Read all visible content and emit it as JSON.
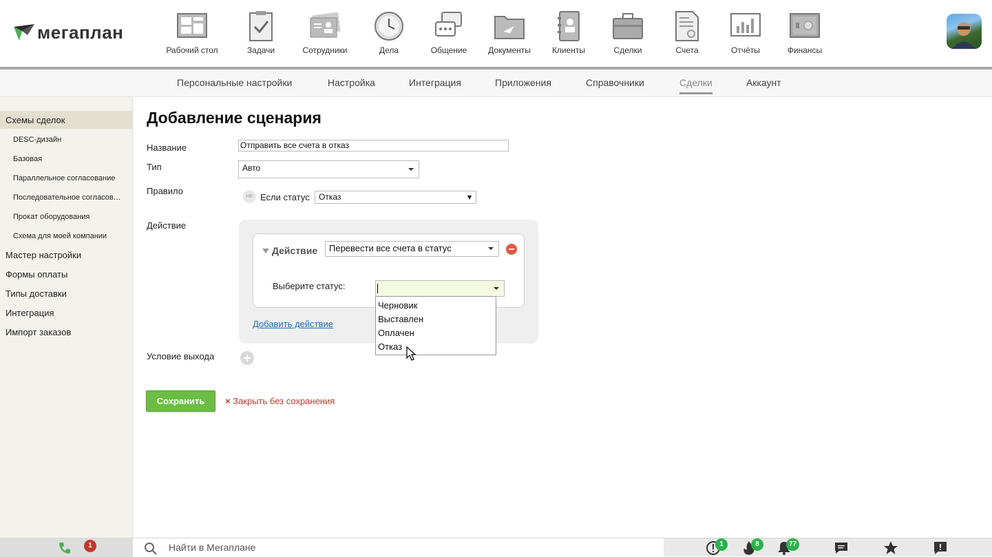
{
  "app": {
    "brand": "мегаплан",
    "nav": [
      {
        "label": "Рабочий стол",
        "icon": "desktop-icon"
      },
      {
        "label": "Задачи",
        "icon": "tasks-icon"
      },
      {
        "label": "Сотрудники",
        "icon": "employees-icon"
      },
      {
        "label": "Дела",
        "icon": "clock-icon"
      },
      {
        "label": "Общение",
        "icon": "chat-icon"
      },
      {
        "label": "Документы",
        "icon": "folder-icon"
      },
      {
        "label": "Клиенты",
        "icon": "contacts-icon"
      },
      {
        "label": "Сделки",
        "icon": "briefcase-icon"
      },
      {
        "label": "Счета",
        "icon": "invoice-icon"
      },
      {
        "label": "Отчёты",
        "icon": "reports-icon"
      },
      {
        "label": "Финансы",
        "icon": "safe-icon"
      }
    ]
  },
  "subnav": {
    "items": [
      "Персональные настройки",
      "Настройка",
      "Интеграция",
      "Приложения",
      "Справочники",
      "Сделки",
      "Аккаунт"
    ],
    "active": "Сделки"
  },
  "sidebar": {
    "section": "Схемы сделок",
    "sub_items": [
      "DESC-дизайн",
      "Базовая",
      "Параллельное согласование",
      "Последовательное согласование",
      "Прокат оборудования",
      "Схема для моей компании"
    ],
    "items": [
      "Мастер настройки",
      "Формы оплаты",
      "Типы доставки",
      "Интеграция",
      "Импорт заказов"
    ]
  },
  "form": {
    "title": "Добавление сценария",
    "name_label": "Название",
    "name_value": "Отправить все счета в отказ",
    "type_label": "Тип",
    "type_value": "Авто",
    "rule_label": "Правило",
    "ne_badge": "НЕ",
    "if_status_label": "Если статус",
    "if_status_value": "Отказ",
    "action_label": "Действие",
    "action_heading": "Действие",
    "action_value": "Перевести все счета в статус",
    "choose_status_label": "Выберите статус:",
    "choose_status_value": "",
    "status_options": [
      "Черновик",
      "Выставлен",
      "Оплачен",
      "Отказ"
    ],
    "add_action": "Добавить действие",
    "exit_condition_label": "Условие выхода",
    "save": "Сохранить",
    "close_without_save": "Закрыть без сохранения",
    "close_mark": "×"
  },
  "bottom": {
    "search_placeholder": "Найти в Мегаплане",
    "phone_badge": "1",
    "alerts_badge": "1",
    "hot_badge": "8",
    "notifications_badge": "77"
  },
  "colors": {
    "accent_green": "#6bbd44",
    "danger_red": "#e2583e",
    "link_blue": "#1e6fb4",
    "badge_green": "#2ab24a",
    "badge_red": "#c0392b"
  }
}
